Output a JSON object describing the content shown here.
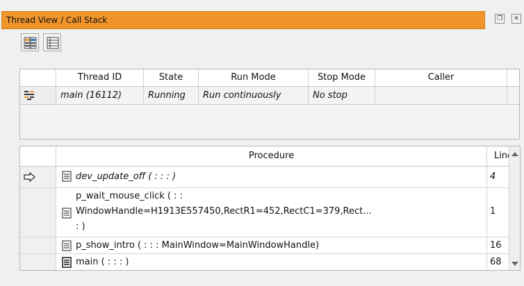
{
  "window": {
    "title": "Thread View / Call Stack",
    "restore_icon": "restore-icon",
    "close_icon": "close-icon"
  },
  "toolbar": {
    "buttons": [
      {
        "icon": "thread-view-icon"
      },
      {
        "icon": "call-stack-list-icon"
      }
    ]
  },
  "thread_table": {
    "headers": [
      "Thread ID",
      "State",
      "Run Mode",
      "Stop Mode",
      "Caller"
    ],
    "rows": [
      {
        "icon": "thread-running-icon",
        "thread_id": "main (16112)",
        "state": "Running",
        "run_mode": "Run continuously",
        "stop_mode": "No stop",
        "caller": ""
      }
    ]
  },
  "procedure_table": {
    "headers": [
      "Procedure",
      "Line"
    ],
    "rows": [
      {
        "marker": "current-line-arrow",
        "icon": "procedure-doc-icon",
        "procedure": "dev_update_off ( : : : )",
        "line": "4",
        "italic": true
      },
      {
        "marker": "",
        "icon": "procedure-doc-icon",
        "procedure_lines": [
          "p_wait_mouse_click ( : :",
          "WindowHandle=H1913E557450,RectR1=452,RectC1=379,Rect...",
          ": )"
        ],
        "line": "1",
        "italic": false
      },
      {
        "marker": "",
        "icon": "procedure-doc-icon",
        "procedure": "p_show_intro ( : : : MainWindow=MainWindowHandle)",
        "line": "16",
        "italic": false
      },
      {
        "marker": "",
        "icon": "main-procedure-icon",
        "procedure": "main ( : : : )",
        "line": "68",
        "italic": false
      }
    ]
  },
  "colors": {
    "title_bar": "#f0952c",
    "panel_bg": "#f0f0f0"
  }
}
